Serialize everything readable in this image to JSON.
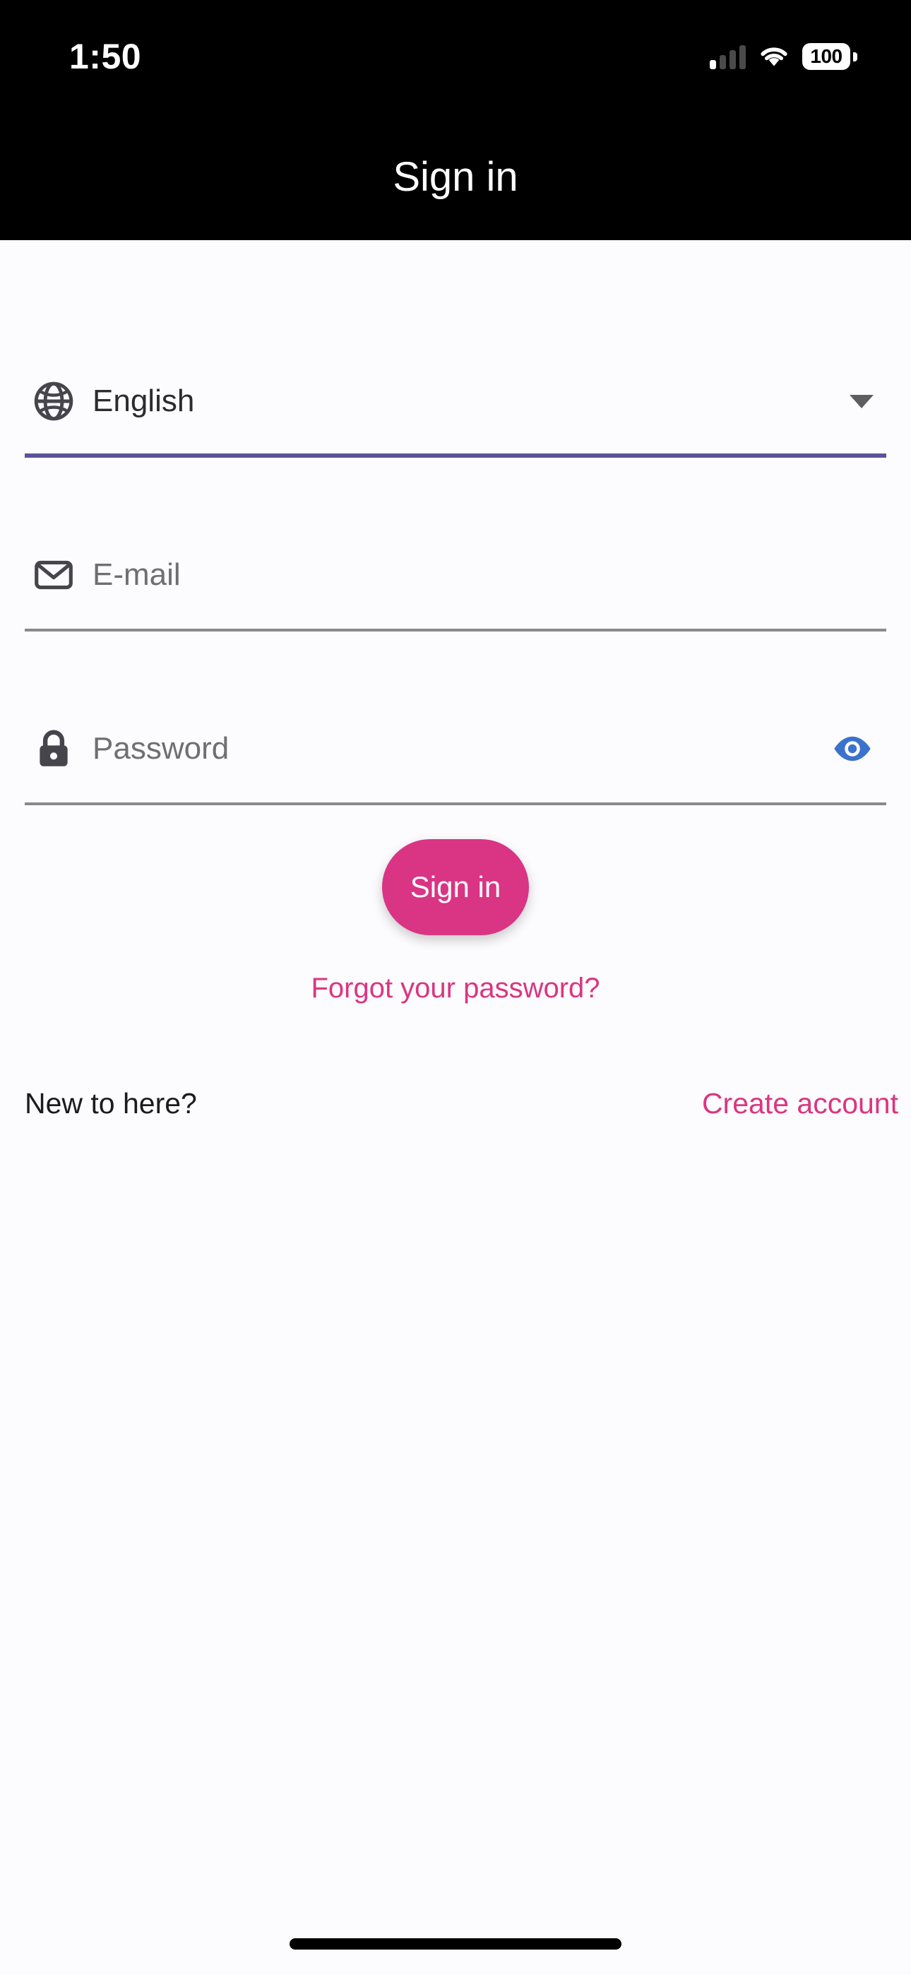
{
  "status_bar": {
    "time": "1:50",
    "battery_level": "100",
    "cellular_icon": "cellular-bars-icon",
    "wifi_icon": "wifi-icon",
    "battery_icon": "battery-icon"
  },
  "navbar": {
    "title": "Sign in"
  },
  "form": {
    "language_field": {
      "icon": "globe-icon",
      "value": "English",
      "dropdown_icon": "chevron-down-icon",
      "focused": true,
      "underline_color": "#5B5399"
    },
    "email_field": {
      "icon": "envelope-icon",
      "value": "",
      "placeholder": "E-mail",
      "underline_color": "#8A8A8E"
    },
    "password_field": {
      "icon": "lock-icon",
      "value": "",
      "placeholder": "Password",
      "toggle_icon": "eye-icon",
      "toggle_color": "#3B72CC",
      "underline_color": "#8A8A8E"
    },
    "submit_button": {
      "label": "Sign in",
      "background": "#D93584",
      "text_color": "#FFFFFF"
    },
    "forgot_password_link": "Forgot your password?",
    "signup_prompt": "New to here?",
    "signup_link": "Create account",
    "link_color": "#DB3581"
  },
  "colors": {
    "page_background": "#FCFBFD",
    "navbar_background": "#000000",
    "accent_pink": "#D93584",
    "accent_purple": "#5B5399",
    "eye_blue": "#3B72CC"
  }
}
